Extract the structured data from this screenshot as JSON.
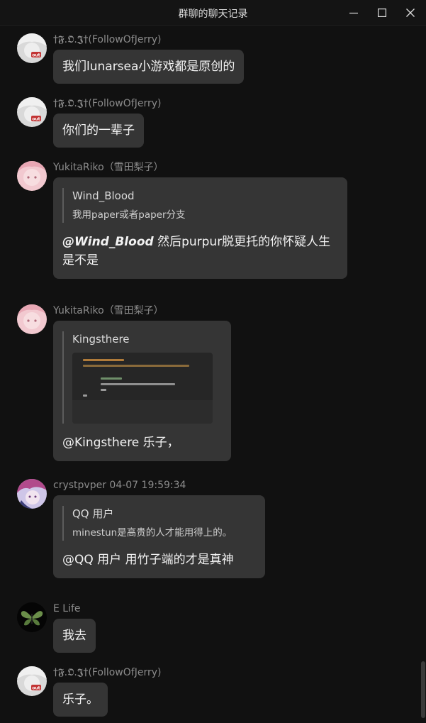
{
  "window": {
    "title": "群聊的聊天记录",
    "min_icon": "minimize-icon",
    "max_icon": "maximize-icon",
    "close_icon": "close-icon"
  },
  "messages": [
    {
      "sender": "†𝕱.𝕺.𝕵†(FollowOfJerry)",
      "avatar": "avatar-white-hair-girl",
      "text": "我们lunarsea小游戏都是原创的"
    },
    {
      "sender": "†𝕱.𝕺.𝕵†(FollowOfJerry)",
      "avatar": "avatar-white-hair-girl",
      "text": "你们的一辈子"
    },
    {
      "sender": "YukitaRiko（雪田梨子）",
      "avatar": "avatar-pink-hair-girl",
      "quote": {
        "name": "Wind_Blood",
        "text": "我用paper或者paper分支"
      },
      "mention": "@Wind_Blood",
      "text": " 然后purpur脱更托的你怀疑人生是不是"
    },
    {
      "sender": "YukitaRiko（雪田梨子）",
      "avatar": "avatar-pink-hair-girl",
      "quote": {
        "name": "Kingsthere",
        "image": "code-screenshot"
      },
      "text": "@Kingsthere 乐子，"
    },
    {
      "sender": "crystpvper",
      "timestamp": "04-07 19:59:34",
      "avatar": "avatar-purple-anime",
      "quote": {
        "name": "QQ 用户",
        "text": "minestun是高贵的人才能用得上的。"
      },
      "text": "@QQ 用户 用竹子端的才是真神"
    },
    {
      "sender": "E Life",
      "avatar": "avatar-green-butterfly",
      "text": "我去"
    },
    {
      "sender": "†𝕱.𝕺.𝕵†(FollowOfJerry)",
      "avatar": "avatar-white-hair-girl",
      "text": "乐子。"
    }
  ]
}
